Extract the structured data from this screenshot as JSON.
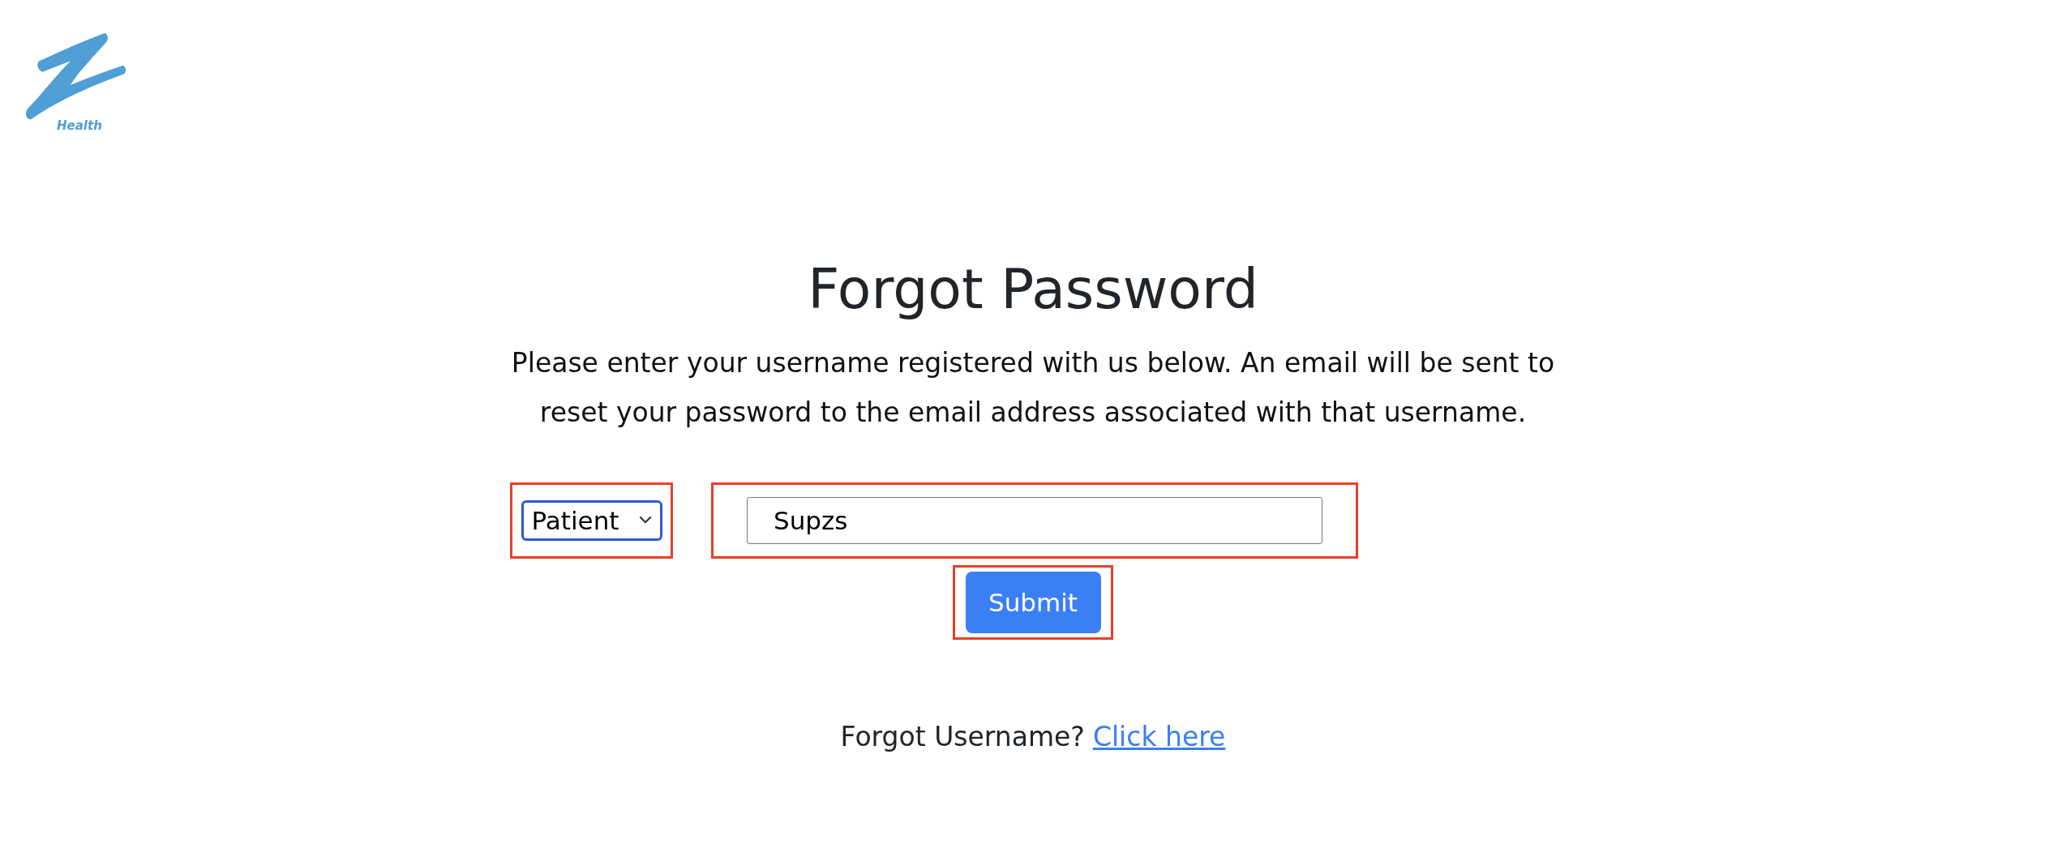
{
  "logo": {
    "text": "Health"
  },
  "title": "Forgot Password",
  "instructions": "Please enter your username registered with us below. An email will be sent to reset your password to the email address associated with that username.",
  "form": {
    "role_select": {
      "value": "Patient",
      "highlighted": true
    },
    "username_field": {
      "value": "Supzs",
      "highlighted": true
    },
    "submit_button": {
      "label": "Submit",
      "highlighted": true
    }
  },
  "footer": {
    "text": "Forgot Username?",
    "link": "Click here"
  }
}
